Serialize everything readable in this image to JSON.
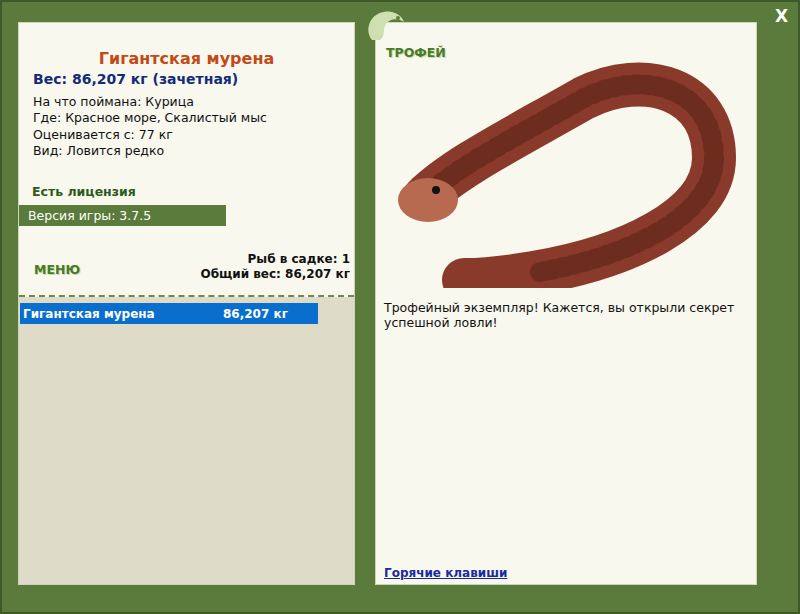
{
  "window": {
    "close": "X"
  },
  "fish": {
    "name": "Гигантская мурена",
    "weight": "Вес: 86,207 кг (зачетная)",
    "details": [
      "На что поймана: Курица",
      "Где: Красное море, Скалистый мыс",
      "Оценивается с: 77 кг",
      "Вид: Ловится редко"
    ]
  },
  "license": "Есть лицензия",
  "version": "Версия игры: 3.7.5",
  "menu": {
    "label": "МЕНЮ"
  },
  "keepnet": {
    "count": "Рыб в садке: 1",
    "total": "Общий вес: 86,207 кг"
  },
  "catch_list": [
    {
      "name": "Гигантская мурена",
      "weight": "86,207 кг",
      "selected": true
    }
  ],
  "trophy": {
    "label": "ТРОФЕЙ",
    "message": "Трофейный экземпляр! Кажется, вы открыли секрет успешной ловли!",
    "hotkeys": "Горячие клавиши"
  }
}
